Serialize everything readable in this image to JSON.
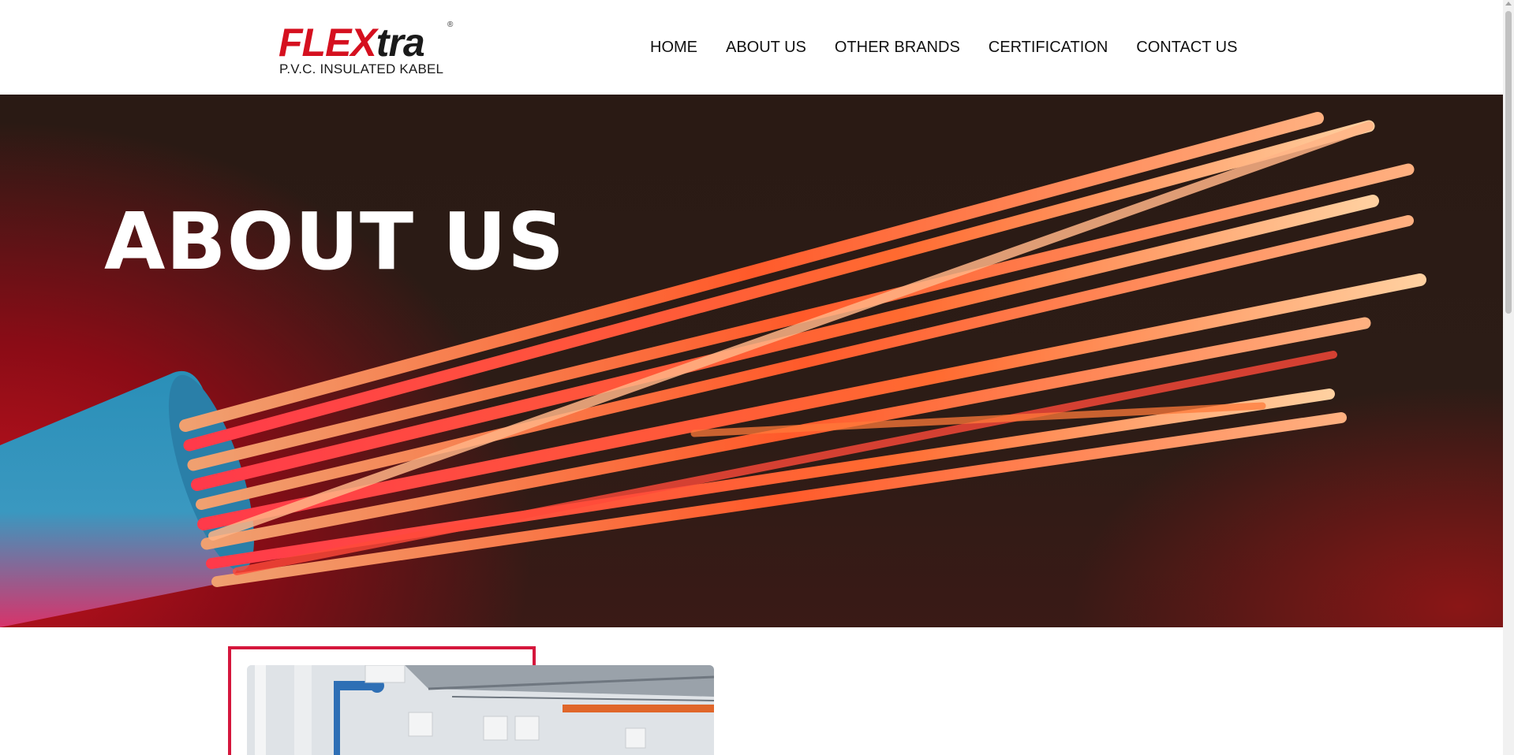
{
  "brand": {
    "name_red": "FLEX",
    "name_dark": "tra",
    "registered": "®",
    "tagline": "P.V.C. INSULATED KABEL",
    "colors": {
      "red": "#d5101f",
      "dark": "#1a1a1a"
    }
  },
  "nav": {
    "items": [
      {
        "label": "HOME"
      },
      {
        "label": "ABOUT US"
      },
      {
        "label": "OTHER BRANDS"
      },
      {
        "label": "CERTIFICATION"
      },
      {
        "label": "CONTACT US"
      }
    ]
  },
  "hero": {
    "title": "ABOUT US",
    "image": "copper-cable-strands"
  },
  "content": {
    "image": "factory-interior",
    "frame_color": "#d5163c"
  },
  "scrollbar": {
    "up_icon": "arrow-up-icon"
  }
}
